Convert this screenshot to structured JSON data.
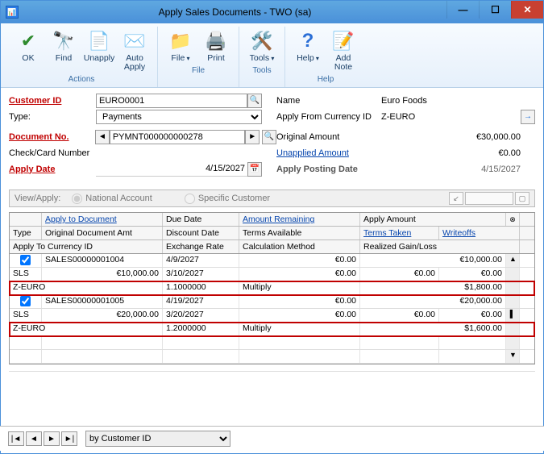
{
  "window": {
    "title": "Apply Sales Documents  -  TWO (sa)"
  },
  "ribbon": {
    "ok": "OK",
    "find": "Find",
    "unapply": "Unapply",
    "auto_apply": "Auto\nApply",
    "file": "File",
    "print": "Print",
    "tools": "Tools",
    "help": "Help",
    "add_note": "Add\nNote",
    "group_actions": "Actions",
    "group_file": "File",
    "group_tools": "Tools",
    "group_help": "Help"
  },
  "form": {
    "customer_id_label": "Customer ID",
    "customer_id": "EURO0001",
    "type_label": "Type:",
    "type": "Payments",
    "name_label": "Name",
    "name": "Euro Foods",
    "apply_from_currency_label": "Apply From Currency ID",
    "apply_from_currency": "Z-EURO",
    "document_no_label": "Document No.",
    "document_no": "PYMNT000000000278",
    "check_card_label": "Check/Card Number",
    "check_card": "",
    "apply_date_label": "Apply Date",
    "apply_date": "4/15/2027",
    "original_amount_label": "Original Amount",
    "original_amount": "€30,000.00",
    "unapplied_amount_label": "Unapplied Amount",
    "unapplied_amount": "€0.00",
    "apply_posting_date_label": "Apply Posting Date",
    "apply_posting_date": "4/15/2027"
  },
  "viewapply": {
    "label": "View/Apply:",
    "opt1": "National Account",
    "opt2": "Specific Customer"
  },
  "grid": {
    "headers1": {
      "c1": "",
      "c2": "Apply to Document",
      "c3": "Due Date",
      "c4": "Amount Remaining",
      "c5": "Apply Amount",
      "c6": ""
    },
    "headers2": {
      "c1": "Type",
      "c2": "Original Document Amt",
      "c3": "Discount Date",
      "c4": "Terms Available",
      "c5": "Terms Taken",
      "c6": "Writeoffs"
    },
    "headers3": {
      "c1": "Apply To Currency ID",
      "c2": "Exchange Rate",
      "c3": "",
      "c4": "Calculation Method",
      "c5": "Realized Gain/Loss",
      "c6": ""
    },
    "rows": [
      {
        "chk": true,
        "doc": "SALES00000001004",
        "date": "4/9/2027",
        "remain": "€0.00",
        "apply": "€10,000.00",
        "scroll": "▲"
      },
      {
        "type": "SLS",
        "orig": "€10,000.00",
        "disc": "3/10/2027",
        "avail": "€0.00",
        "taken": "€0.00",
        "wo": "€0.00"
      },
      {
        "curr": "Z-EURO",
        "rate": "1.1000000",
        "method": "Multiply",
        "gain": "$1,800.00",
        "red": true
      },
      {
        "chk": true,
        "doc": "SALES00000001005",
        "date": "4/19/2027",
        "remain": "€0.00",
        "apply": "€20,000.00"
      },
      {
        "type": "SLS",
        "orig": "€20,000.00",
        "disc": "3/20/2027",
        "avail": "€0.00",
        "taken": "€0.00",
        "wo": "€0.00",
        "scroll": "▌"
      },
      {
        "curr": "Z-EURO",
        "rate": "1.2000000",
        "method": "Multiply",
        "gain": "$1,600.00",
        "red": true
      }
    ]
  },
  "nav": {
    "sort_by": "by Customer ID"
  }
}
